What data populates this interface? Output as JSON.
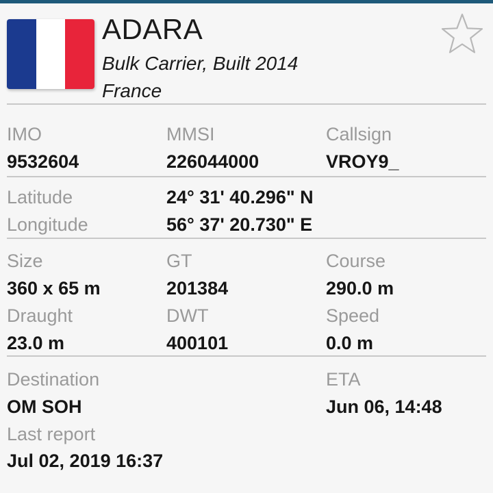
{
  "vessel": {
    "name": "ADARA",
    "type_built": "Bulk Carrier, Built 2014",
    "country": "France",
    "flag_colors": [
      "#1b3a8f",
      "#ffffff",
      "#e8243a"
    ]
  },
  "favorite": {
    "icon": "star-outline-icon"
  },
  "ids": {
    "imo_label": "IMO",
    "imo_value": "9532604",
    "mmsi_label": "MMSI",
    "mmsi_value": "226044000",
    "callsign_label": "Callsign",
    "callsign_value": "VROY9_"
  },
  "position": {
    "latitude_label": "Latitude",
    "latitude_value": "24° 31' 40.296\" N",
    "longitude_label": "Longitude",
    "longitude_value": "56° 37' 20.730\" E"
  },
  "dimensions": {
    "size_label": "Size",
    "size_value": "360 x 65 m",
    "gt_label": "GT",
    "gt_value": "201384",
    "course_label": "Course",
    "course_value": "290.0 m",
    "draught_label": "Draught",
    "draught_value": "23.0 m",
    "dwt_label": "DWT",
    "dwt_value": "400101",
    "speed_label": "Speed",
    "speed_value": "0.0 m"
  },
  "voyage": {
    "destination_label": "Destination",
    "destination_value": "OM SOH",
    "eta_label": "ETA",
    "eta_value": "Jun 06, 14:48",
    "last_report_label": "Last report",
    "last_report_value": "Jul 02, 2019 16:37"
  },
  "colors": {
    "accent_bar": "#1f5a7a",
    "label": "#9a9a9a",
    "value": "#161616",
    "divider": "#c8c8c8"
  }
}
